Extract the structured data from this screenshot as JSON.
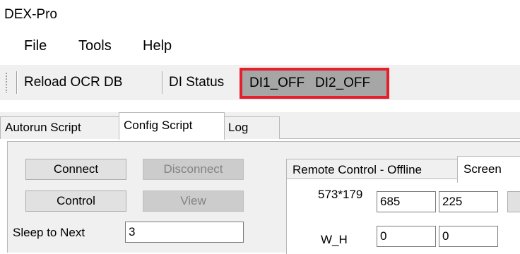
{
  "window": {
    "title": "DEX-Pro"
  },
  "menubar": {
    "items": [
      "File",
      "Tools",
      "Help"
    ]
  },
  "toolbar": {
    "reload_label": "Reload OCR DB",
    "di_status_label": "DI Status",
    "di1_state": "DI1_OFF",
    "di2_state": "DI2_OFF",
    "highlight_color": "#e5202c"
  },
  "tabs": [
    {
      "label": "Autorun Script",
      "active": false
    },
    {
      "label": "Config Script",
      "active": true
    },
    {
      "label": "Log",
      "active": false
    }
  ],
  "panel": {
    "connect_label": "Connect",
    "disconnect_label": "Disconnect",
    "control_label": "Control",
    "view_label": "View",
    "sleep_label": "Sleep to Next",
    "sleep_value": "3",
    "inner_tabs": [
      {
        "label": "Remote Control - Offline",
        "active": false
      },
      {
        "label": "Screen",
        "active": true
      }
    ],
    "resolution_label": "573*179",
    "pos_x": "685",
    "pos_y": "225",
    "wh_label": "W_H",
    "w_value": "0",
    "h_value": "0"
  }
}
